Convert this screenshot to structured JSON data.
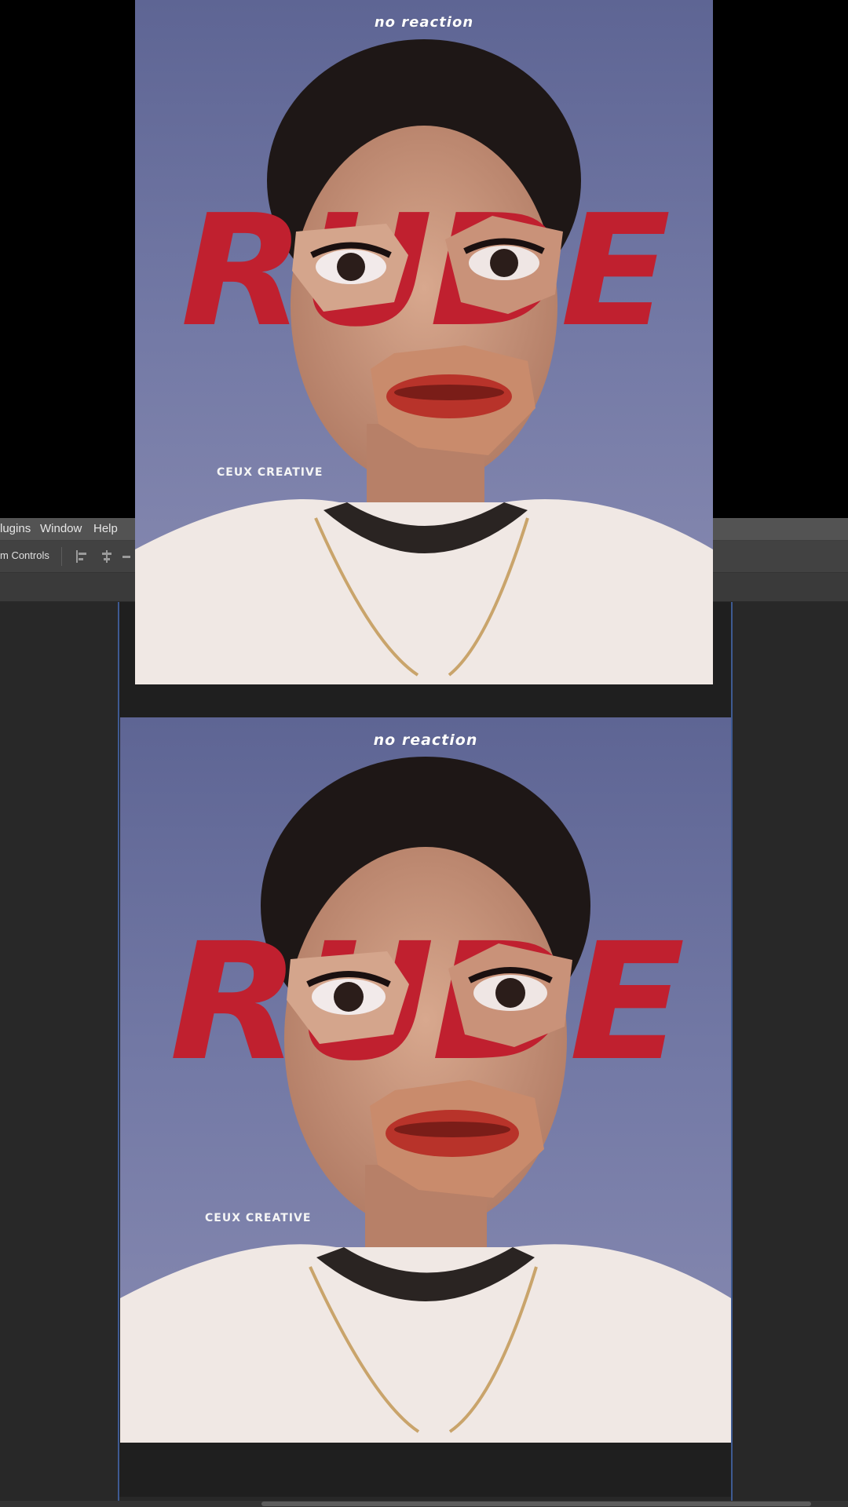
{
  "menu": {
    "items": [
      "lugins",
      "Window",
      "Help"
    ]
  },
  "options_bar": {
    "label": "m Controls"
  },
  "album_cover": {
    "caption": "no reaction",
    "title": "RUDE",
    "credit": "CEUX CREATIVE"
  },
  "colors": {
    "title_red": "#c0202f",
    "backdrop_blue": "#6e6f9c",
    "editor_dark": "#282828",
    "menu_gray": "#535353",
    "guide_blue": "#3e5a92"
  },
  "icons": [
    "align-left-icon",
    "align-center-icon",
    "align-right-icon"
  ]
}
